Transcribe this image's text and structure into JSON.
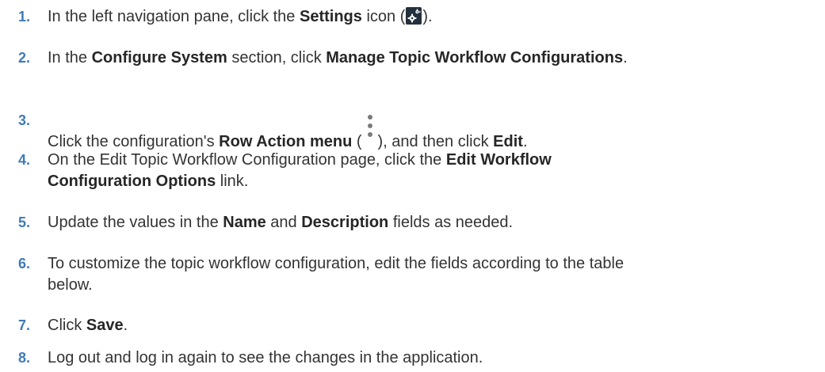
{
  "steps": [
    {
      "number": "1.",
      "pre": "In the left navigation pane, click the ",
      "bold1": "Settings",
      "mid": " icon (",
      "icon": "settings-gear-icon",
      "post": ")."
    },
    {
      "number": "2.",
      "pre": "In the ",
      "bold1": "Configure System",
      "mid": " section, click ",
      "bold2": "Manage Topic Workflow Configurations",
      "post": "."
    },
    {
      "number": "3.",
      "pre": "Click the configuration's ",
      "bold1": "Row Action menu",
      "mid": " (",
      "icon": "kebab-menu-icon",
      "mid2": "), and then click ",
      "bold2": "Edit",
      "post": "."
    },
    {
      "number": "4.",
      "pre": "On the Edit Topic Workflow Configuration page, click the ",
      "bold1": "Edit Workflow",
      "bold1b": "Configuration Options",
      "post": " link."
    },
    {
      "number": "5.",
      "pre": "Update the values in the ",
      "bold1": "Name",
      "mid": " and ",
      "bold2": "Description",
      "post": " fields as needed."
    },
    {
      "number": "6.",
      "line1": "To customize the topic workflow configuration, edit the fields according to the table",
      "line2": "below."
    },
    {
      "number": "7.",
      "pre": "Click ",
      "bold1": "Save",
      "post": "."
    },
    {
      "number": "8.",
      "text": "Log out and log in again to see the changes in the application."
    }
  ]
}
